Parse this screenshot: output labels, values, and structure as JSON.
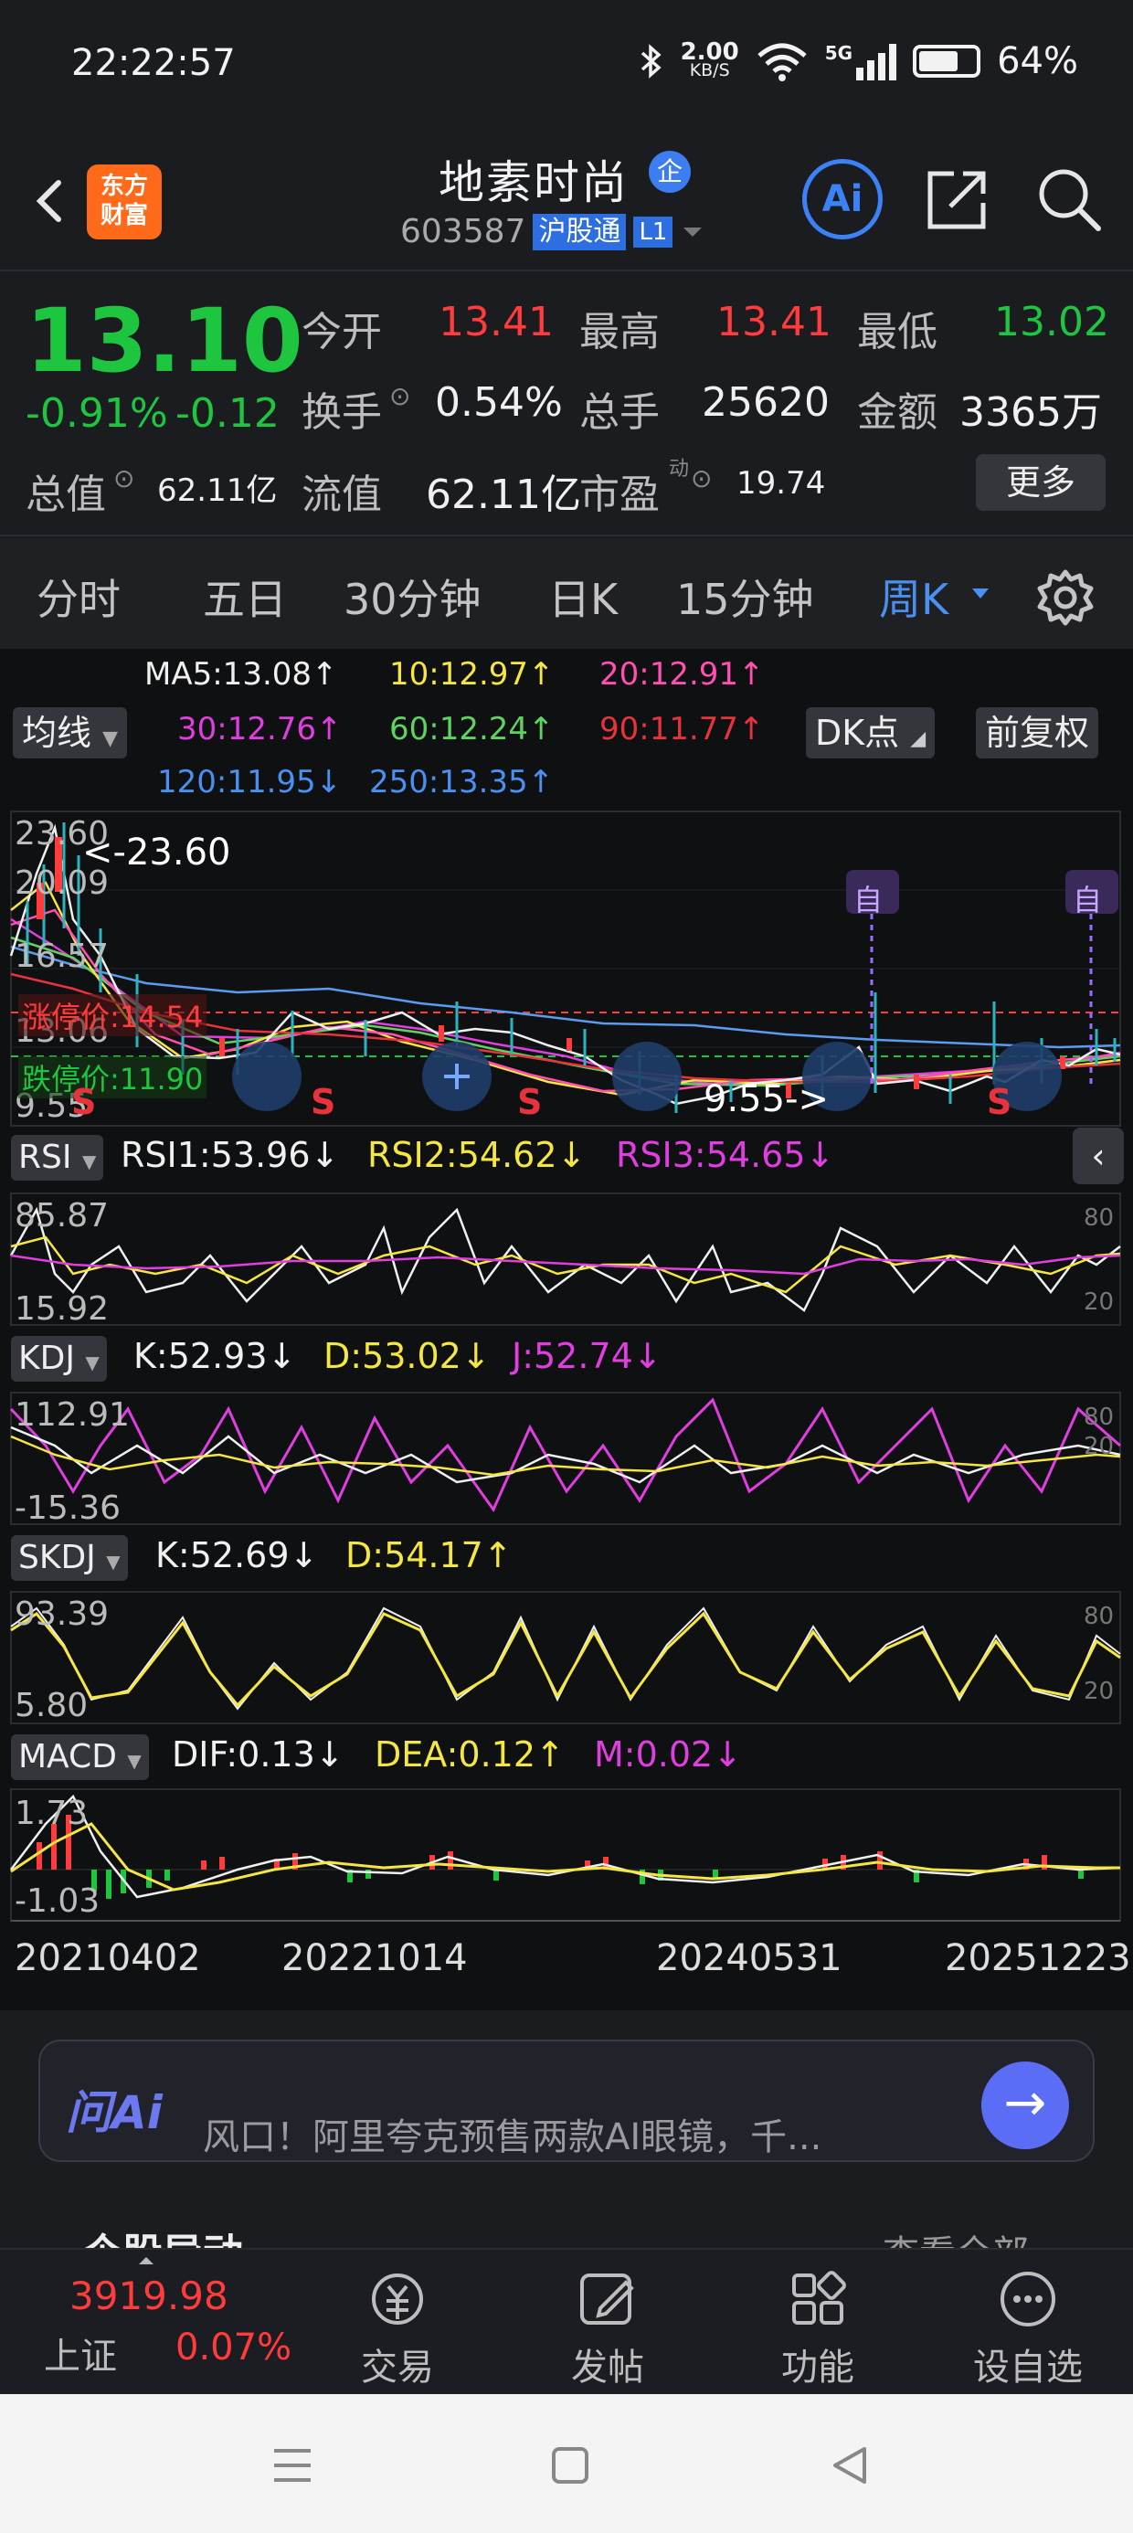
{
  "status": {
    "time": "22:22:57",
    "net_speed": "2.00",
    "net_unit": "KB/S",
    "signal": "5G",
    "battery": "64%"
  },
  "header": {
    "logo_line1": "东方",
    "logo_line2": "财富",
    "title": "地素时尚",
    "title_badge": "企",
    "code": "603587",
    "tag_connect": "沪股通",
    "tag_level": "L1",
    "ai_label": "Ai"
  },
  "quote": {
    "price": "13.10",
    "pct": "-0.91%",
    "chg": "-0.12",
    "open_label": "今开",
    "open": "13.41",
    "high_label": "最高",
    "high": "13.41",
    "low_label": "最低",
    "low": "13.02",
    "turnover_label": "换手",
    "turnover": "0.54%",
    "volume_label": "总手",
    "volume": "25620",
    "amount_label": "金额",
    "amount": "3365万",
    "mcap_label": "总值",
    "mcap": "62.11亿",
    "float_label": "流值",
    "float": "62.11亿",
    "pe_label": "市盈",
    "pe_sup": "动",
    "pe": "19.74",
    "more_label": "更多"
  },
  "tabs": [
    "分时",
    "五日",
    "30分钟",
    "日K",
    "15分钟",
    "周K"
  ],
  "active_tab": "周K",
  "chart": {
    "ma": {
      "ma5": "MA5:13.08↑",
      "ma10": "10:12.97↑",
      "ma20": "20:12.91↑",
      "ma30": "30:12.76↑",
      "ma60": "60:12.24↑",
      "ma90": "90:11.77↑",
      "ma120": "120:11.95↓",
      "ma250": "250:13.35↑"
    },
    "btn_ma": "均线",
    "btn_dk": "DK点",
    "btn_adj": "前复权",
    "price_axis": [
      "23.60",
      "20.09",
      "16.57",
      "13.06",
      "9.55"
    ],
    "max_mark": "<-23.60",
    "min_mark": "9.55->",
    "limit_up": "涨停价:14.54",
    "limit_down": "跌停价:11.90",
    "self_tag": "自",
    "signal_s": "S",
    "rsi": {
      "name": "RSI",
      "v1": "RSI1:53.96↓",
      "v2": "RSI2:54.62↓",
      "v3": "RSI3:54.65↓",
      "top": "85.87",
      "bot": "15.92",
      "hi": "80",
      "lo": "20"
    },
    "kdj": {
      "name": "KDJ",
      "k": "K:52.93↓",
      "d": "D:53.02↓",
      "j": "J:52.74↓",
      "top": "112.91",
      "bot": "-15.36",
      "hi": "80",
      "lo": "20"
    },
    "skdj": {
      "name": "SKDJ",
      "k": "K:52.69↓",
      "d": "D:54.17↑",
      "top": "93.39",
      "bot": "5.80",
      "hi": "80",
      "lo": "20"
    },
    "macd": {
      "name": "MACD",
      "dif": "DIF:0.13↓",
      "dea": "DEA:0.12↑",
      "m": "M:0.02↓",
      "top": "1.73",
      "bot": "-1.03"
    },
    "dates": [
      "20210402",
      "20221014",
      "20240531",
      "20251223"
    ]
  },
  "ai_bar": {
    "label": "问Ai",
    "text": "风口！阿里夸克预售两款AI眼镜，千..."
  },
  "peek": {
    "left": "个股异动",
    "right": "查看全部"
  },
  "bottom_nav": {
    "index_value": "3919.98",
    "index_name": "上证",
    "index_pct": "0.07%",
    "trade": "交易",
    "post": "发帖",
    "func": "功能",
    "watch": "设自选"
  },
  "colors": {
    "up": "#ff3b3b",
    "down": "#1ec640",
    "accent": "#4a90f0",
    "ma_yellow": "#f5e642",
    "ma_magenta": "#e03ee0"
  }
}
